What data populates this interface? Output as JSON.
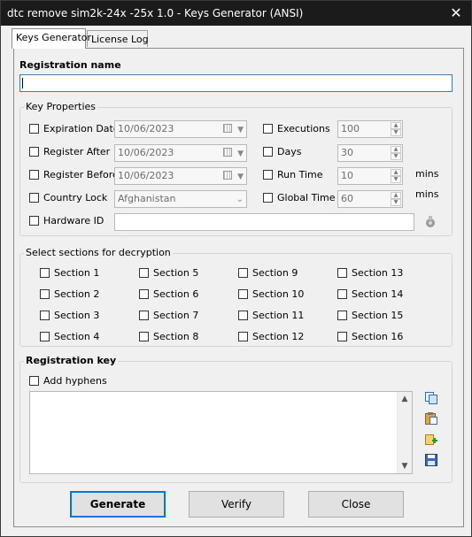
{
  "window": {
    "title": "dtc remove sim2k-24x -25x 1.0 - Keys Generator (ANSI)",
    "close_glyph": "✕"
  },
  "tabs": [
    {
      "label": "Keys Generator"
    },
    {
      "label": "License Log"
    }
  ],
  "registration": {
    "title": "Registration name",
    "value": ""
  },
  "key_properties": {
    "title": "Key Properties",
    "expiration_date": {
      "label": "Expiration Date",
      "value": "10/06/2023"
    },
    "register_after": {
      "label": "Register After",
      "value": "10/06/2023"
    },
    "register_before": {
      "label": "Register Before",
      "value": "10/06/2023"
    },
    "country_lock": {
      "label": "Country Lock",
      "value": "Afghanistan"
    },
    "hardware_id": {
      "label": "Hardware ID",
      "value": ""
    },
    "executions": {
      "label": "Executions",
      "value": "100"
    },
    "days": {
      "label": "Days",
      "value": "30"
    },
    "run_time": {
      "label": "Run Time",
      "value": "10",
      "unit": "mins"
    },
    "global_time": {
      "label": "Global Time",
      "value": "60",
      "unit": "mins"
    }
  },
  "sections": {
    "title": "Select sections for decryption",
    "items": [
      "Section 1",
      "Section 2",
      "Section 3",
      "Section 4",
      "Section 5",
      "Section 6",
      "Section 7",
      "Section 8",
      "Section 9",
      "Section 10",
      "Section 11",
      "Section 12",
      "Section 13",
      "Section 14",
      "Section 15",
      "Section 16"
    ]
  },
  "reg_key": {
    "title": "Registration key",
    "add_hyphens": "Add hyphens",
    "value": ""
  },
  "buttons": {
    "generate": "Generate",
    "verify": "Verify",
    "close": "Close"
  },
  "icons": [
    "copy-icon",
    "paste-icon",
    "add-key-icon",
    "save-icon",
    "hardware-id-icon"
  ]
}
